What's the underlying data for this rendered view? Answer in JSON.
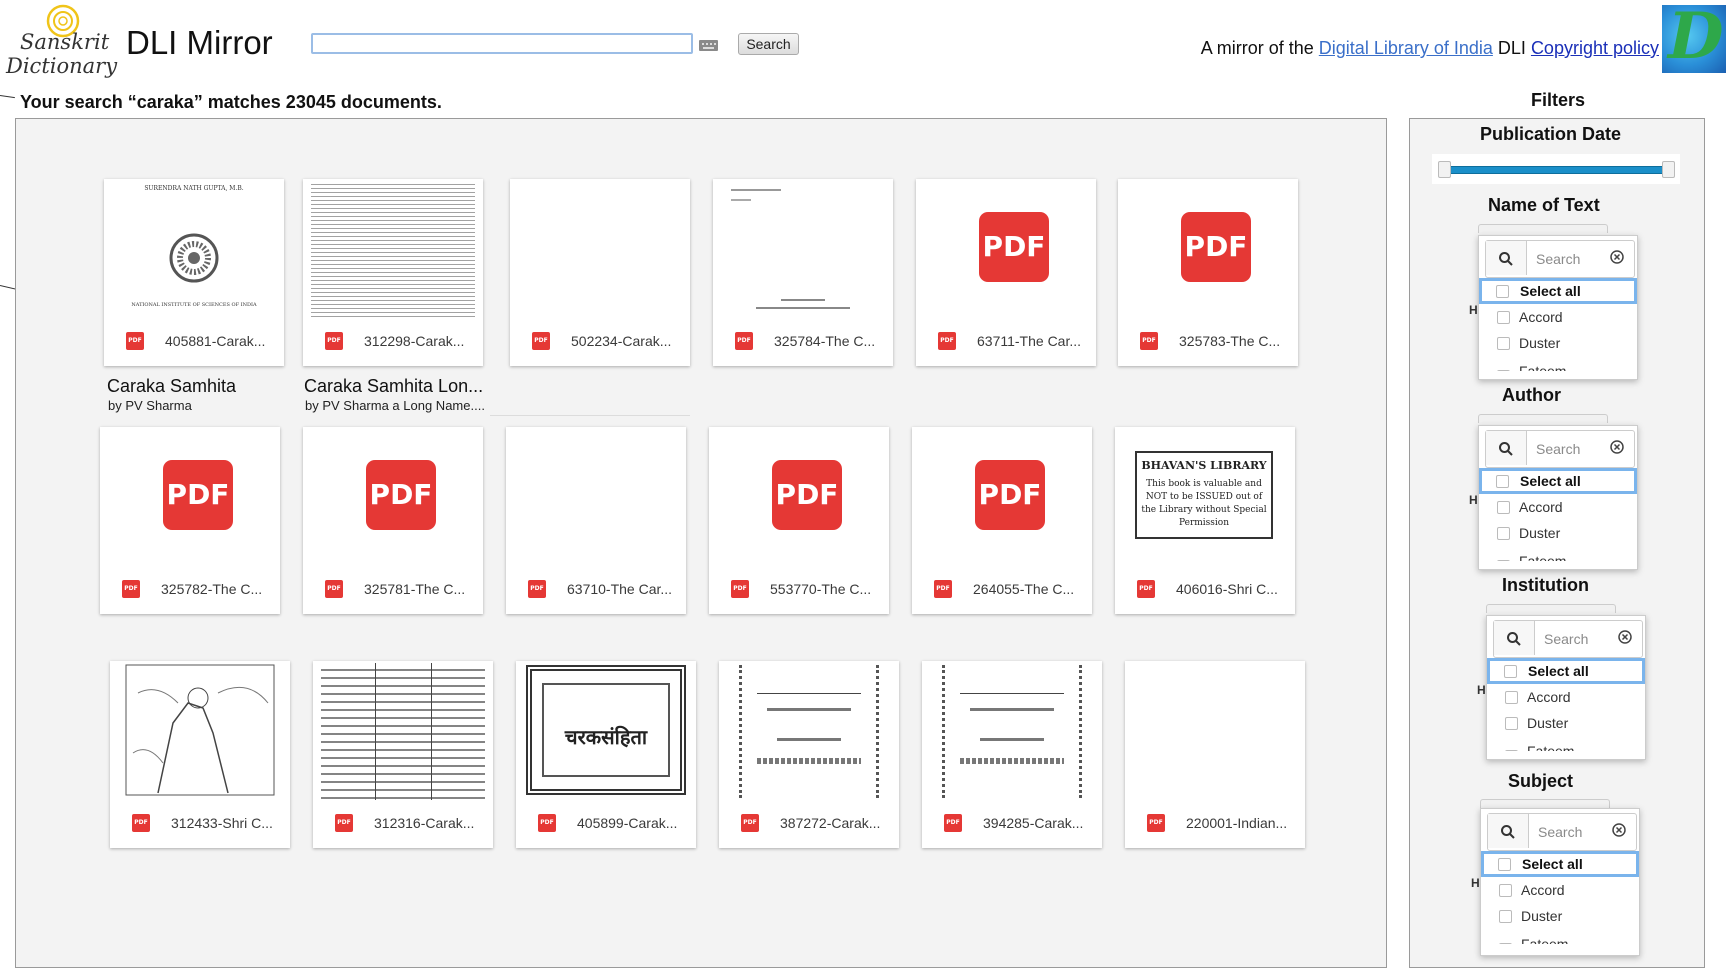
{
  "header": {
    "logo_line1": "Sanskrit",
    "logo_line2": "Dictionary",
    "site_title": "DLI Mirror",
    "search_value": "",
    "search_button": "Search",
    "mirror_prefix": "A mirror of the",
    "dli_link": "Digital Library of India",
    "dli_suffix": "DLI",
    "copyright_link": "Copyright policy",
    "dli_logo_letter": "D"
  },
  "results": {
    "heading": "Your search “caraka” matches 23045 documents.",
    "cards": [
      {
        "label": "405881-Carak...",
        "thumb": "emblem",
        "title": "Caraka Samhita",
        "byline": "by PV Sharma"
      },
      {
        "label": "312298-Carak...",
        "thumb": "textpage",
        "title": "Caraka Samhita Lon...",
        "byline": "by PV Sharma a Long Name...."
      },
      {
        "label": "502234-Carak...",
        "thumb": "blank"
      },
      {
        "label": "325784-The C...",
        "thumb": "sparse"
      },
      {
        "label": "63711-The Car...",
        "thumb": "pdf"
      },
      {
        "label": "325783-The C...",
        "thumb": "pdf"
      },
      {
        "label": "325782-The C...",
        "thumb": "pdf"
      },
      {
        "label": "325781-The C...",
        "thumb": "pdf"
      },
      {
        "label": "63710-The Car...",
        "thumb": "blank"
      },
      {
        "label": "553770-The C...",
        "thumb": "pdf"
      },
      {
        "label": "264055-The C...",
        "thumb": "pdf"
      },
      {
        "label": "406016-Shri C...",
        "thumb": "library"
      },
      {
        "label": "312433-Shri C...",
        "thumb": "sketch"
      },
      {
        "label": "312316-Carak...",
        "thumb": "table"
      },
      {
        "label": "405899-Carak...",
        "thumb": "ornate"
      },
      {
        "label": "387272-Carak...",
        "thumb": "sanskrit"
      },
      {
        "label": "394285-Carak...",
        "thumb": "sanskrit"
      },
      {
        "label": "220001-Indian...",
        "thumb": "blank"
      }
    ],
    "pdf_badge": "PDF",
    "library_stamp": {
      "title": "BHAVAN'S LIBRARY",
      "text": "This book is valuable and NOT to be ISSUED out of the Library without Special Permission"
    },
    "emblem_top": "SURENDRA NATH GUPTA, M.B.",
    "emblem_bottom": "NATIONAL INSTITUTE OF SCIENCES OF INDIA",
    "ornate_text": "चरकसंहिता"
  },
  "filters": {
    "heading": "Filters",
    "publication_date": "Publication Date",
    "groups": [
      {
        "title": "Name of Text",
        "search_placeholder": "Search",
        "options": [
          "Select all",
          "Accord",
          "Duster",
          "Fateem"
        ]
      },
      {
        "title": "Author",
        "search_placeholder": "Search",
        "options": [
          "Select all",
          "Accord",
          "Duster",
          "Fateem"
        ]
      },
      {
        "title": "Institution",
        "search_placeholder": "Search",
        "options": [
          "Select all",
          "Accord",
          "Duster",
          "Fateem"
        ]
      },
      {
        "title": "Subject",
        "search_placeholder": "Search",
        "options": [
          "Select all",
          "Accord",
          "Duster",
          "Fateem"
        ]
      }
    ],
    "side_mark": "H"
  },
  "colors": {
    "pdf_red": "#e53835",
    "link_blue": "#3a6fc9",
    "slider_blue": "#1a8fc9",
    "select_border": "#7ab4ec"
  }
}
